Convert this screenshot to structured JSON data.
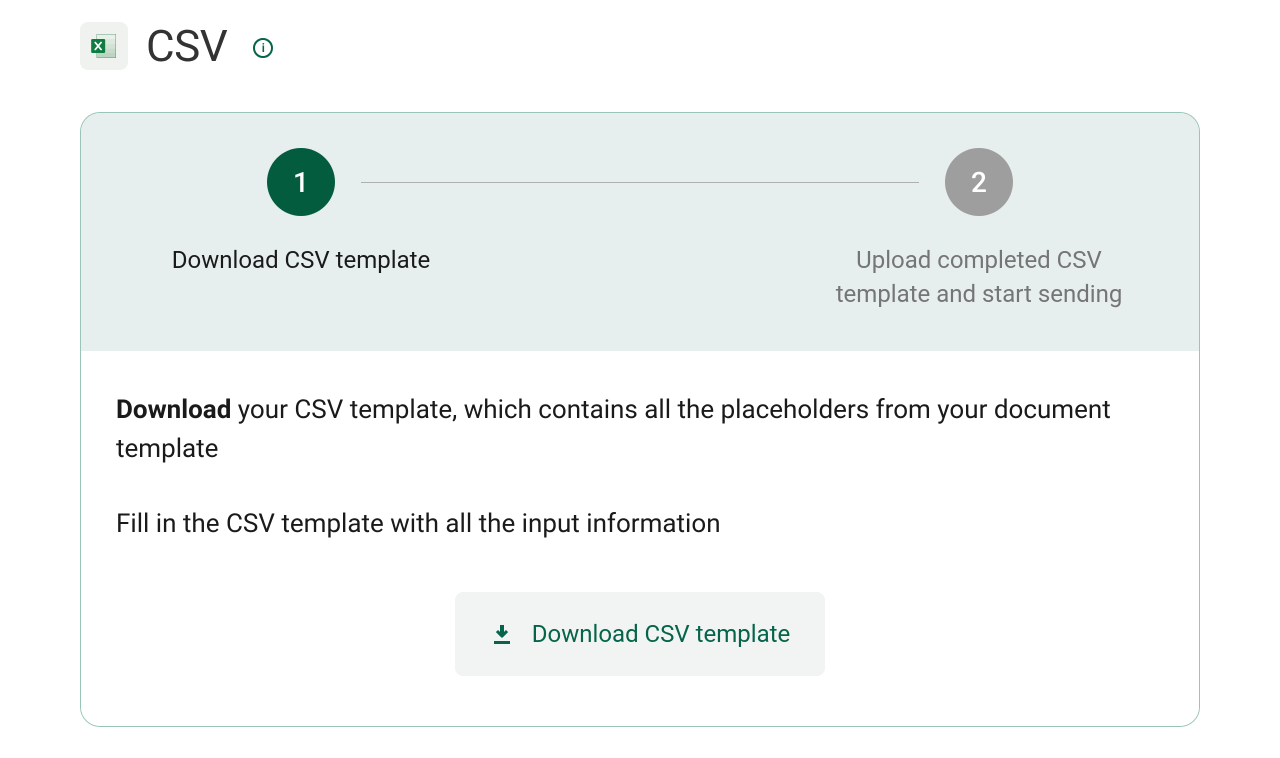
{
  "header": {
    "title": "CSV"
  },
  "stepper": {
    "step1": {
      "number": "1",
      "label": "Download CSV template"
    },
    "step2": {
      "number": "2",
      "label": "Upload completed CSV template and start sending"
    }
  },
  "content": {
    "instruction1_bold": "Download",
    "instruction1_rest": " your CSV template, which contains all the placeholders from your document template",
    "instruction2": "Fill in the CSV template with all the input information",
    "download_button_label": "Download CSV template"
  }
}
